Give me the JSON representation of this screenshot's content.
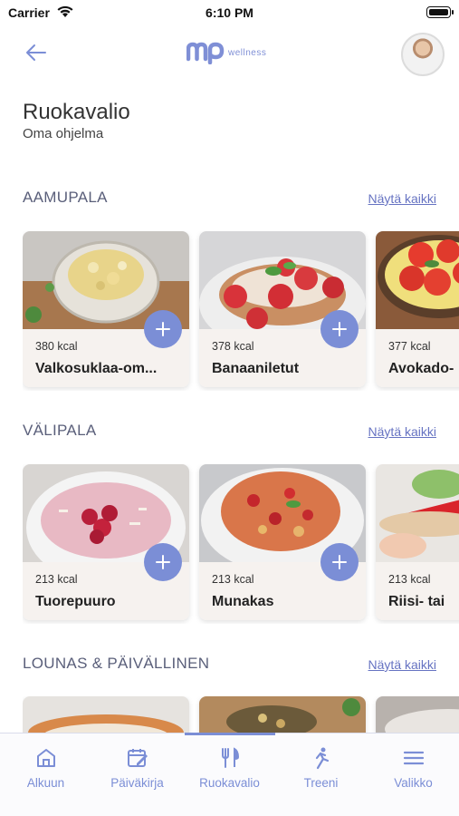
{
  "status_bar": {
    "carrier": "Carrier",
    "time": "6:10 PM"
  },
  "header": {
    "logo_text": "wellness"
  },
  "page": {
    "title": "Ruokavalio",
    "subtitle": "Oma ohjelma"
  },
  "sections": [
    {
      "title": "AAMUPALA",
      "show_all": "Näytä kaikki",
      "cards": [
        {
          "kcal": "380 kcal",
          "name": "Valkosuklaa-om..."
        },
        {
          "kcal": "378 kcal",
          "name": "Banaaniletut"
        },
        {
          "kcal": "377 kcal",
          "name": "Avokado-"
        }
      ]
    },
    {
      "title": "VÄLIPALA",
      "show_all": "Näytä kaikki",
      "cards": [
        {
          "kcal": "213 kcal",
          "name": "Tuorepuuro"
        },
        {
          "kcal": "213 kcal",
          "name": "Munakas"
        },
        {
          "kcal": "213 kcal",
          "name": "Riisi- tai"
        }
      ]
    },
    {
      "title": "LOUNAS & PÄIVÄLLINEN",
      "show_all": "Näytä kaikki",
      "cards": []
    }
  ],
  "tabs": [
    {
      "label": "Alkuun",
      "icon": "home-icon"
    },
    {
      "label": "Päiväkirja",
      "icon": "calendar-edit-icon"
    },
    {
      "label": "Ruokavalio",
      "icon": "cutlery-icon",
      "active": true
    },
    {
      "label": "Treeni",
      "icon": "running-icon"
    },
    {
      "label": "Valikko",
      "icon": "menu-icon"
    }
  ],
  "colors": {
    "accent": "#7b8ed6",
    "link": "#6673c2",
    "section_title": "#5a5f7a"
  }
}
